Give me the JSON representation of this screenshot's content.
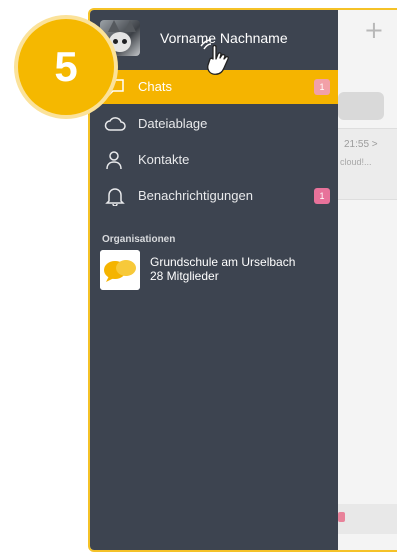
{
  "step_number": "5",
  "profile": {
    "name": "Vorname Nachname"
  },
  "menu": [
    {
      "label": "Chats",
      "icon": "chat-icon",
      "badge": "1",
      "active": true
    },
    {
      "label": "Dateiablage",
      "icon": "cloud-icon",
      "badge": "",
      "active": false
    },
    {
      "label": "Kontakte",
      "icon": "contact-icon",
      "badge": "",
      "active": false
    },
    {
      "label": "Benachrichtigungen",
      "icon": "bell-icon",
      "badge": "1",
      "active": false
    }
  ],
  "organizations": {
    "title": "Organisationen",
    "items": [
      {
        "name": "Grundschule am Urselbach",
        "members": "28 Mitglieder"
      }
    ]
  },
  "background_app": {
    "add_icon": "+",
    "time": "21:55 >",
    "preview": "cloud!..."
  },
  "colors": {
    "drawer": "#3d4450",
    "accent": "#f5b400",
    "badge": "#e8729a",
    "frame": "#f5c227"
  }
}
